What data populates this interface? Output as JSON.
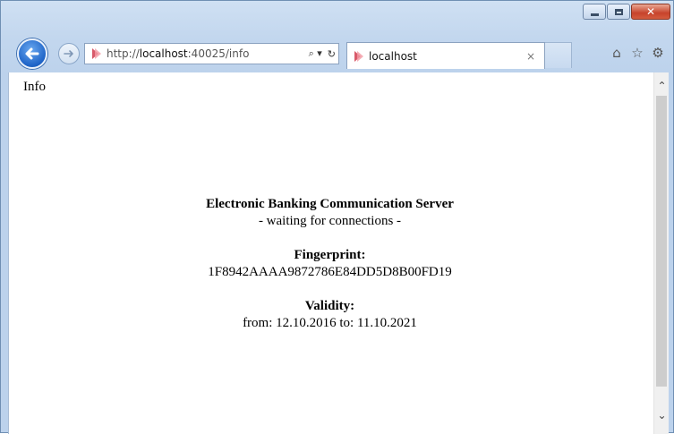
{
  "window": {
    "caption": {
      "minimize": "minimize-icon",
      "maximize": "maximize-icon",
      "close": "✕"
    }
  },
  "nav": {
    "url_prefix": "http://",
    "url_host": "localhost",
    "url_suffix": ":40025/info",
    "search_glyph": "⌕ ▾",
    "refresh_glyph": "↻"
  },
  "tab": {
    "title": "localhost",
    "close_glyph": "×"
  },
  "toolbar": {
    "home_glyph": "⌂",
    "favorites_glyph": "☆",
    "settings_glyph": "⚙"
  },
  "page": {
    "heading": "Info",
    "server_title": "Electronic Banking Communication Server",
    "server_status": "- waiting for connections -",
    "fingerprint_label": "Fingerprint:",
    "fingerprint_value": "1F8942AAAA9872786E84DD5D8B00FD19",
    "validity_label": "Validity:",
    "validity_value": "from: 12.10.2016 to: 11.10.2021"
  },
  "colors": {
    "accent": "#1d63c7",
    "close_red": "#c7432b"
  }
}
